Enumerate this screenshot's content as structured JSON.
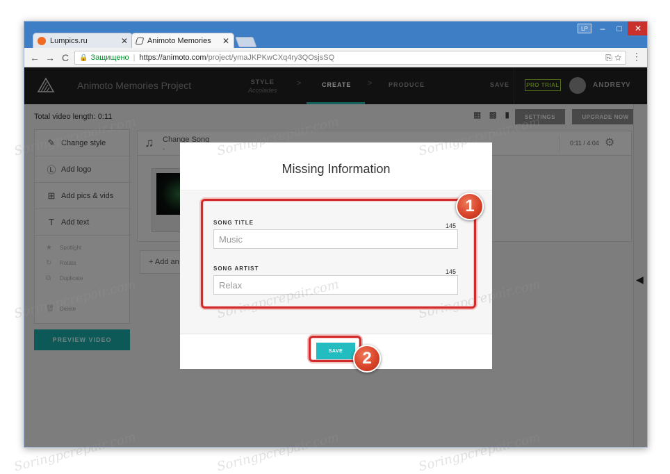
{
  "browser": {
    "tabs": [
      {
        "title": "Lumpics.ru",
        "close": "✕"
      },
      {
        "title": "Animoto Memories",
        "close": "✕"
      }
    ],
    "profile_badge": "LP",
    "window_controls": {
      "minimize": "–",
      "maximize": "□",
      "close": "✕"
    },
    "nav": {
      "back": "←",
      "forward": "→",
      "reload": "C"
    },
    "address": {
      "lock": "🔒",
      "secure_label": "Защищено",
      "separator": "|",
      "url_host": "https://animoto.com",
      "url_path": "/project/ymaJKPKwCXq4ry3QOsjsSQ",
      "icons": "⎘  ☆"
    },
    "menu": "⋮"
  },
  "app_header": {
    "project_title": "Animoto Memories Project",
    "steps": [
      {
        "label": "STYLE",
        "sub": "Accolades"
      },
      {
        "label": "CREATE"
      },
      {
        "label": "PRODUCE"
      }
    ],
    "arrow": ">",
    "save": "SAVE",
    "pro_trial": "PRO TRIAL",
    "user": "ANDREY",
    "user_chevron": "∨",
    "accent_color": "#2cb7b0"
  },
  "workspace": {
    "length_label": "Total video length: 0:11",
    "view_icons": "▦ ▩ ▮",
    "settings_button": "SETTINGS",
    "upgrade_button": "UPGRADE NOW",
    "panel": {
      "items": [
        {
          "icon": "✎",
          "label": "Change style"
        },
        {
          "icon": "Ⓛ",
          "label": "Add logo"
        },
        {
          "icon": "⊞",
          "label": "Add pics & vids"
        },
        {
          "icon": "T",
          "label": "Add text"
        }
      ],
      "sub_items": [
        {
          "icon": "★",
          "label": "Spotlight"
        },
        {
          "icon": "↻",
          "label": "Rotate"
        },
        {
          "icon": "⧉",
          "label": "Duplicate"
        },
        {
          "icon": "🗑",
          "label": "Delete"
        }
      ]
    },
    "preview_button": "PREVIEW VIDEO",
    "song": {
      "icon": "♫",
      "label": "Change Song",
      "sub": "-",
      "time": "0:11 / 4:04",
      "gear": "⚙"
    },
    "add_another": "+ Add an",
    "edge_arrow": "◀"
  },
  "modal": {
    "title": "Missing Information",
    "fields": [
      {
        "label": "SONG TITLE",
        "count": "145",
        "value": "Music"
      },
      {
        "label": "SONG ARTIST",
        "count": "145",
        "value": "Relax"
      }
    ],
    "save_button": "SAVE",
    "save_color": "#23bcc0"
  },
  "annotations": {
    "marker_1": "1",
    "marker_2": "2",
    "highlight_color": "#d22b2b"
  },
  "watermark": "Soringpcrepair.com"
}
